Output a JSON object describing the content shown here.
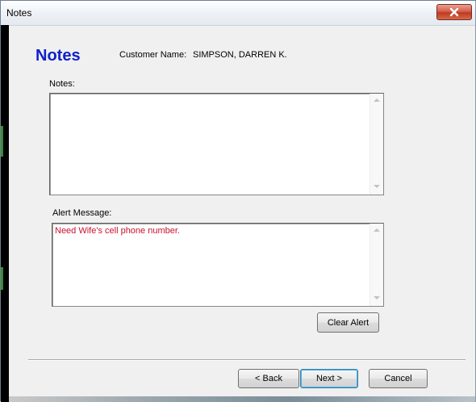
{
  "window": {
    "title": "Notes",
    "close_icon": "close-icon"
  },
  "header": {
    "heading": "Notes",
    "customer_label": "Customer Name:",
    "customer_name": "SIMPSON, DARREN K."
  },
  "notes": {
    "label": "Notes:",
    "value": ""
  },
  "alert": {
    "label": "Alert Message:",
    "value": "Need Wife's cell phone number.",
    "value_color": "#c8102e",
    "clear_button": "Clear Alert"
  },
  "footer": {
    "back": "< Back",
    "next": "Next >",
    "cancel": "Cancel"
  },
  "colors": {
    "heading": "#1022c8",
    "close_button": "#c0391f"
  }
}
